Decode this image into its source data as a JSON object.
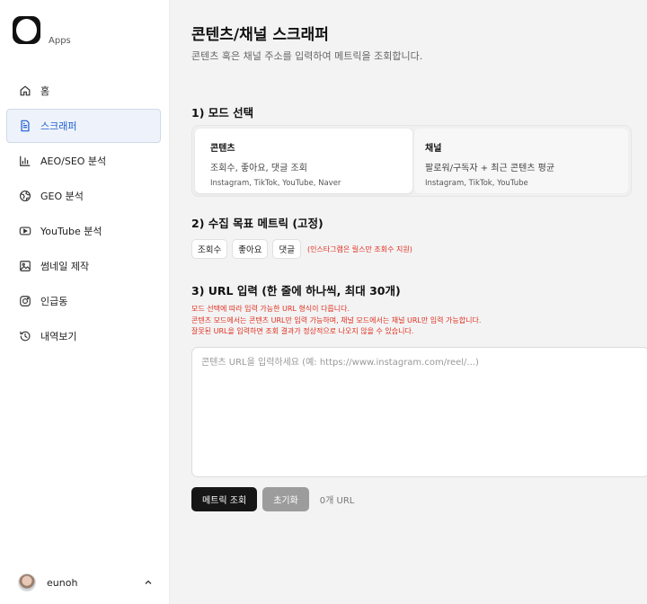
{
  "brand": {
    "name": "Apps"
  },
  "nav": [
    {
      "label": "홈",
      "icon": "home-icon",
      "active": false
    },
    {
      "label": "스크래퍼",
      "icon": "document-icon",
      "active": true
    },
    {
      "label": "AEO/SEO 분석",
      "icon": "bar-chart-icon",
      "active": false
    },
    {
      "label": "GEO 분석",
      "icon": "globe-icon",
      "active": false
    },
    {
      "label": "YouTube 분석",
      "icon": "youtube-icon",
      "active": false
    },
    {
      "label": "썸네일 제작",
      "icon": "image-icon",
      "active": false
    },
    {
      "label": "인급동",
      "icon": "instagram-icon",
      "active": false
    },
    {
      "label": "내역보기",
      "icon": "history-icon",
      "active": false
    }
  ],
  "user": {
    "name": "eunoh"
  },
  "page": {
    "title": "콘텐츠/채널 스크래퍼",
    "subtitle": "콘텐츠 혹은 채널 주소를 입력하여 메트릭을 조회합니다."
  },
  "mode_section": {
    "title": "1) 모드 선택",
    "options": [
      {
        "name": "콘텐츠",
        "desc": "조회수, 좋아요, 댓글 조회",
        "platforms": "Instagram, TikTok, YouTube, Naver",
        "selected": true
      },
      {
        "name": "채널",
        "desc": "팔로워/구독자 + 최근 콘텐츠 평균",
        "platforms": "Instagram, TikTok, YouTube",
        "selected": false
      }
    ]
  },
  "metrics_section": {
    "title": "2) 수집 목표 메트릭 (고정)",
    "chips": [
      "조회수",
      "좋아요",
      "댓글"
    ],
    "note": "(인스타그램은 릴스만 조회수 지원)"
  },
  "url_section": {
    "title": "3) URL 입력 (한 줄에 하나씩, 최대 30개)",
    "notes": [
      "모드 선택에 따라 입력 가능한 URL 형식이 다릅니다.",
      "콘텐츠 모드에서는 콘텐츠 URL만 입력 가능하며, 채널 모드에서는 채널 URL만 입력 가능합니다.",
      "잘못된 URL을 입력하면 조회 결과가 정상적으로 나오지 않을 수 있습니다."
    ],
    "placeholder": "콘텐츠 URL을 입력하세요 (예: https://www.instagram.com/reel/...)",
    "value": ""
  },
  "actions": {
    "submit_label": "메트릭 조회",
    "reset_label": "초기화",
    "count_text": "0개 URL"
  },
  "colors": {
    "accent": "#1f5fd1",
    "warning": "#e0301e",
    "primary_button": "#161616",
    "secondary_button": "#9c9c9c"
  }
}
